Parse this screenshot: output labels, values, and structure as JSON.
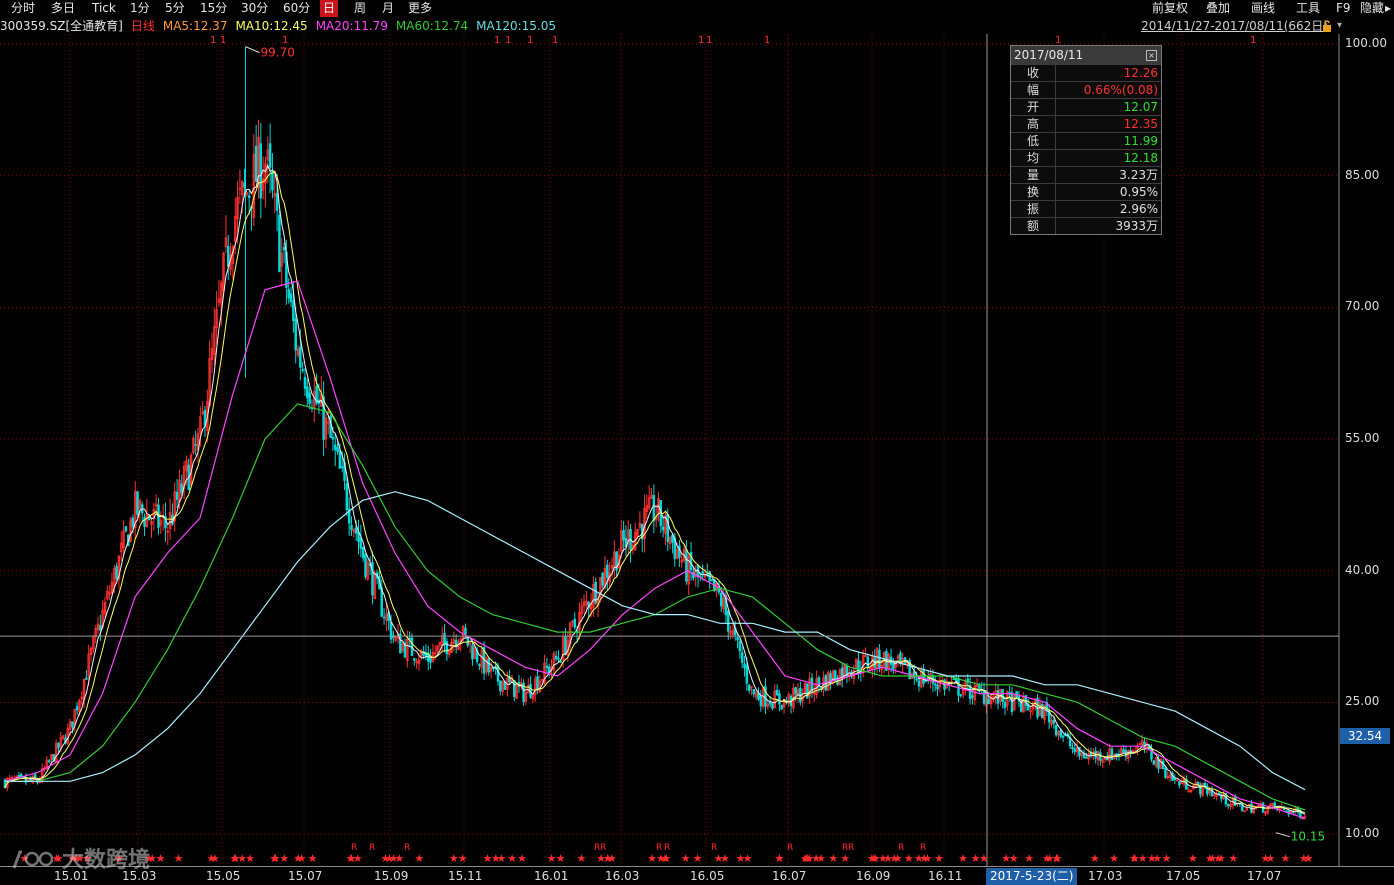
{
  "toolbar": {
    "periods": [
      "分时",
      "多日",
      "Tick",
      "1分",
      "5分",
      "15分",
      "30分",
      "60分",
      "日",
      "周",
      "月",
      "更多"
    ],
    "active": "日",
    "right": [
      "前复权",
      "叠加",
      "画线",
      "工具",
      "F9",
      "隐藏"
    ]
  },
  "info": {
    "code": "300359.SZ",
    "name": "[全通教育]",
    "period": "日线",
    "ma5": "MA5:12.37",
    "ma10": "MA10:12.45",
    "ma20": "MA20:11.79",
    "ma60": "MA60:12.74",
    "ma120": "MA120:15.05",
    "range": "2014/11/27-2017/08/11(662日)"
  },
  "colors": {
    "up": "#ff3232",
    "down": "#00d8d8",
    "ma5": "#f0f0f0",
    "ma10": "#ffff66",
    "ma20": "#ff44ff",
    "ma60": "#33cc33",
    "ma120": "#aaf0ff",
    "grid": "#8b0000"
  },
  "infobox": {
    "date": "2017/08/11",
    "rows": [
      {
        "label": "收",
        "value": "12.26",
        "color": "#ff3030"
      },
      {
        "label": "幅",
        "value": "0.66%(0.08)",
        "color": "#ff3030"
      },
      {
        "label": "开",
        "value": "12.07",
        "color": "#33dd33"
      },
      {
        "label": "高",
        "value": "12.35",
        "color": "#ff3030"
      },
      {
        "label": "低",
        "value": "11.99",
        "color": "#33dd33"
      },
      {
        "label": "均",
        "value": "12.18",
        "color": "#33dd33"
      },
      {
        "label": "量",
        "value": "3.23万",
        "color": "#e0e0e0"
      },
      {
        "label": "换",
        "value": "0.95%",
        "color": "#e0e0e0"
      },
      {
        "label": "振",
        "value": "2.96%",
        "color": "#e0e0e0"
      },
      {
        "label": "额",
        "value": "3933万",
        "color": "#e0e0e0"
      }
    ]
  },
  "price_axis": [
    "100.00",
    "85.00",
    "70.00",
    "55.00",
    "40.00",
    "25.00",
    "10.00"
  ],
  "cursor_price": "32.54",
  "cursor_date": "2017-5-23(二)",
  "high_label": "99.70",
  "low_label": "10.15",
  "date_axis": [
    "15.01",
    "15.03",
    "15.05",
    "15.07",
    "15.09",
    "15.11",
    "16.01",
    "16.03",
    "16.05",
    "16.07",
    "16.09",
    "16.11",
    "17.03",
    "17.05",
    "17.07"
  ],
  "watermark": "大数跨境",
  "chart_data": {
    "type": "line",
    "title": "",
    "ylim": [
      10,
      100
    ],
    "x_ticks": [
      "15.01",
      "15.03",
      "15.05",
      "15.07",
      "15.09",
      "15.11",
      "16.01",
      "16.03",
      "16.05",
      "16.07",
      "16.09",
      "16.11",
      "17.03",
      "17.05",
      "17.07"
    ],
    "price_path": [
      [
        0,
        16
      ],
      [
        1,
        16
      ],
      [
        2,
        22
      ],
      [
        3,
        35
      ],
      [
        4,
        47
      ],
      [
        5,
        45
      ],
      [
        6,
        55
      ],
      [
        7,
        80
      ],
      [
        8,
        87
      ],
      [
        9,
        65
      ],
      [
        10,
        55
      ],
      [
        11,
        42
      ],
      [
        12,
        32
      ],
      [
        13,
        30
      ],
      [
        14,
        33
      ],
      [
        15,
        28
      ],
      [
        16,
        26
      ],
      [
        17,
        30
      ],
      [
        18,
        37
      ],
      [
        19,
        43
      ],
      [
        20,
        47
      ],
      [
        21,
        40
      ],
      [
        22,
        37
      ],
      [
        23,
        26
      ],
      [
        24,
        25
      ],
      [
        25,
        27
      ],
      [
        26,
        29
      ],
      [
        27,
        30
      ],
      [
        28,
        28
      ],
      [
        29,
        27
      ],
      [
        30,
        26
      ],
      [
        31,
        25
      ],
      [
        32,
        24
      ],
      [
        33,
        19
      ],
      [
        34,
        19
      ],
      [
        35,
        20
      ],
      [
        36,
        16
      ],
      [
        37,
        15
      ],
      [
        38,
        13
      ],
      [
        39,
        13
      ],
      [
        40,
        12.26
      ]
    ],
    "series": [
      {
        "name": "MA20",
        "values": [
          16,
          17,
          19,
          26,
          37,
          42,
          46,
          60,
          72,
          73,
          62,
          50,
          42,
          36,
          33,
          31,
          29,
          28,
          31,
          35,
          38,
          40,
          38,
          33,
          28,
          27,
          28,
          29,
          28,
          27,
          26,
          26,
          25,
          22,
          20,
          20,
          18,
          16,
          14,
          13,
          11.79
        ]
      },
      {
        "name": "MA60",
        "values": [
          16,
          16,
          17,
          20,
          25,
          31,
          38,
          46,
          55,
          59,
          58,
          52,
          45,
          40,
          37,
          35,
          34,
          33,
          33,
          34,
          35,
          37,
          38,
          37,
          34,
          31,
          29,
          28,
          28,
          28,
          27,
          27,
          26,
          25,
          23,
          21,
          20,
          18,
          16,
          14,
          12.74
        ]
      },
      {
        "name": "MA120",
        "values": [
          16,
          16,
          16,
          17,
          19,
          22,
          26,
          31,
          36,
          41,
          45,
          48,
          49,
          48,
          46,
          44,
          42,
          40,
          38,
          36,
          35,
          35,
          34,
          34,
          33,
          33,
          31,
          30,
          29,
          28,
          28,
          28,
          27,
          27,
          26,
          25,
          24,
          22,
          20,
          17,
          15.05
        ]
      }
    ]
  }
}
